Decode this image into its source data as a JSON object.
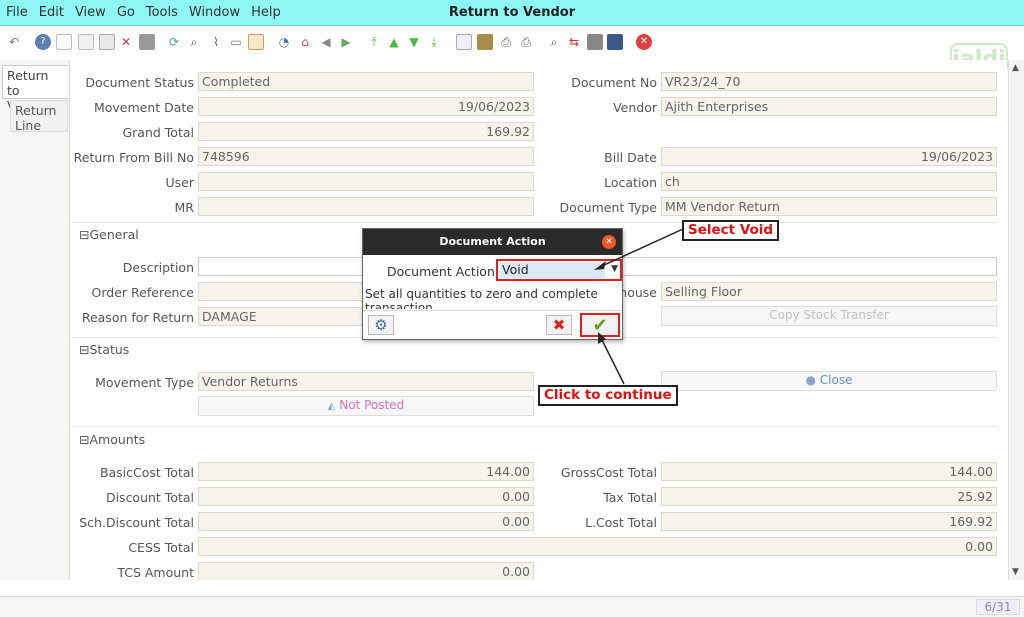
{
  "menu": {
    "file": "File",
    "edit": "Edit",
    "view": "View",
    "go": "Go",
    "tools": "Tools",
    "window": "Window",
    "help": "Help"
  },
  "window": {
    "title": "Return to Vendor"
  },
  "logo": {
    "text": "jaldi"
  },
  "tabs": {
    "return_to_vendor": "Return to Vendor",
    "return_line": "Return Line"
  },
  "header": {
    "document_status_label": "Document Status",
    "document_status": "Completed",
    "document_no_label": "Document No",
    "document_no": "VR23/24_70",
    "movement_date_label": "Movement Date",
    "movement_date": "19/06/2023",
    "vendor_label": "Vendor",
    "vendor": "Ajith Enterprises",
    "grand_total_label": "Grand Total",
    "grand_total": "169.92",
    "return_from_bill_no_label": "Return From Bill No",
    "return_from_bill_no": "748596",
    "bill_date_label": "Bill Date",
    "bill_date": "19/06/2023",
    "user_label": "User",
    "user": "",
    "location_label": "Location",
    "location": "ch",
    "mr_label": "MR",
    "mr": "",
    "document_type_label": "Document Type",
    "document_type": "MM Vendor Return"
  },
  "general": {
    "section_title": "General",
    "description_label": "Description",
    "description": "",
    "order_reference_label": "Order Reference",
    "order_reference": "",
    "warehouse_label_partial": "house",
    "warehouse": "Selling Floor",
    "reason_for_return_label": "Reason for Return",
    "reason_for_return": "DAMAGE",
    "copy_stock_transfer": "Copy Stock Transfer"
  },
  "status": {
    "section_title": "Status",
    "movement_type_label": "Movement Type",
    "movement_type": "Vendor Returns",
    "close_button": "Close",
    "not_posted": "Not Posted"
  },
  "amounts": {
    "section_title": "Amounts",
    "basic_cost_total_label": "BasicCost Total",
    "basic_cost_total": "144.00",
    "gross_cost_total_label": "GrossCost Total",
    "gross_cost_total": "144.00",
    "discount_total_label": "Discount Total",
    "discount_total": "0.00",
    "tax_total_label": "Tax Total",
    "tax_total": "25.92",
    "sch_discount_total_label": "Sch.Discount Total",
    "sch_discount_total": "0.00",
    "l_cost_total_label": "L.Cost Total",
    "l_cost_total": "169.92",
    "cess_total_label": "CESS Total",
    "cess_total": "0.00",
    "tcs_amount_label": "TCS Amount",
    "tcs_amount": "0.00"
  },
  "dialog": {
    "title": "Document Action",
    "field_label": "Document Action",
    "selected_value": "Void",
    "help_text": "Set all quantities to zero and complete transaction"
  },
  "callouts": {
    "select_void": "Select Void",
    "click_to_continue": "Click to continue"
  },
  "statusbar": {
    "page": "6/31"
  }
}
